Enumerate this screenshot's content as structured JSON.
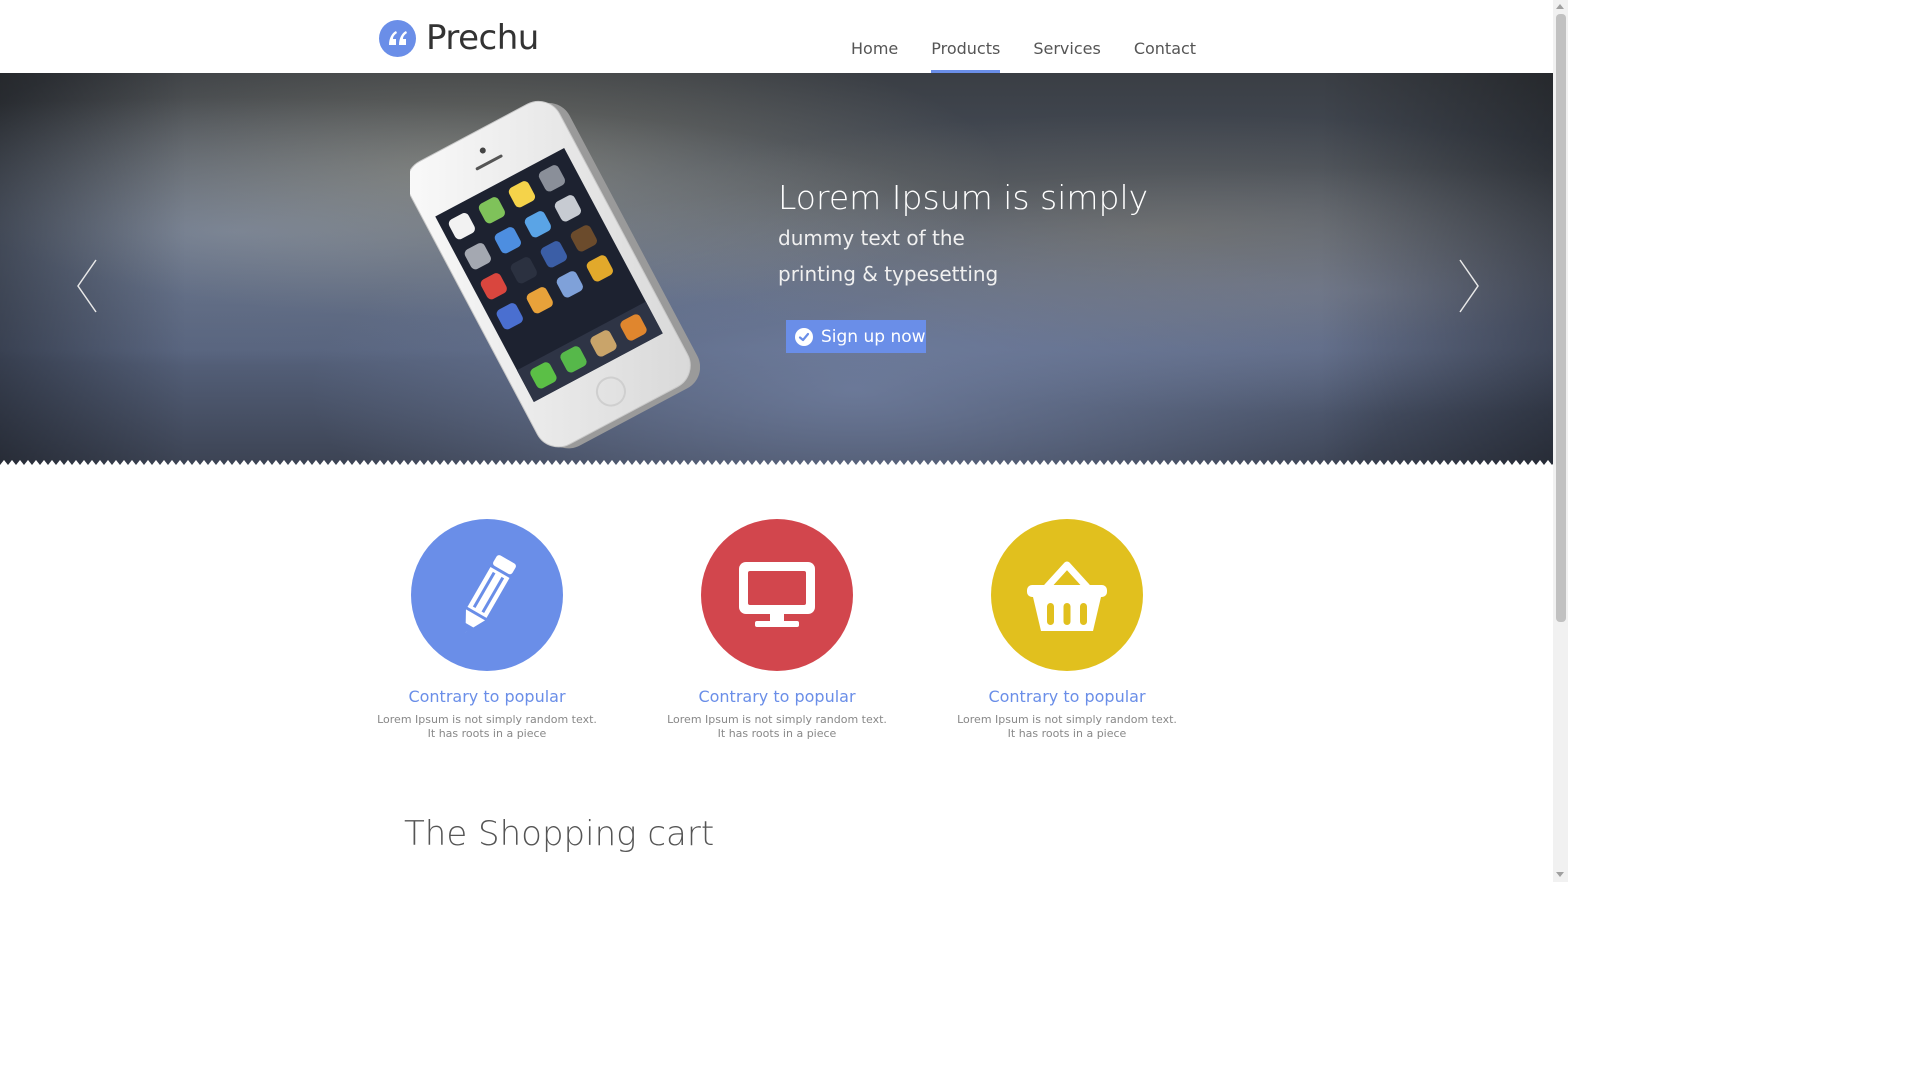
{
  "brand": {
    "name": "Prechu",
    "logo_icon": "quote-icon",
    "accent": "#6a8ee8"
  },
  "nav": {
    "items": [
      {
        "label": "Home",
        "active": false
      },
      {
        "label": "Products",
        "active": true
      },
      {
        "label": "Services",
        "active": false
      },
      {
        "label": "Contact",
        "active": false
      }
    ]
  },
  "hero": {
    "title": "Lorem Ipsum is simply",
    "subtitle_line1": "dummy text of the",
    "subtitle_line2": "printing & typesetting",
    "cta_label": "Sign up now",
    "cta_icon": "check-circle-icon",
    "prev_icon": "chevron-left-icon",
    "next_icon": "chevron-right-icon"
  },
  "features": [
    {
      "title": "Contrary to popular",
      "text": "Lorem Ipsum is not simply random text. It has roots in a piece",
      "icon": "pencil-icon",
      "color": "#6a8ee8"
    },
    {
      "title": "Contrary to popular",
      "text": "Lorem Ipsum is not simply random text. It has roots in a piece",
      "icon": "monitor-icon",
      "color": "#d2464d"
    },
    {
      "title": "Contrary to popular",
      "text": "Lorem Ipsum is not simply random text. It has roots in a piece",
      "icon": "basket-icon",
      "color": "#e1c01e"
    }
  ],
  "cart_section": {
    "title": "The Shopping cart"
  }
}
